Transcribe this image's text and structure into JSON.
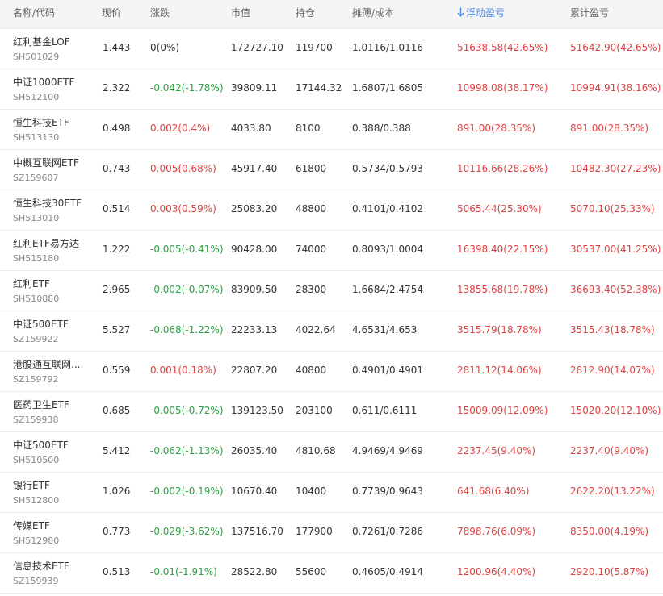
{
  "columns": {
    "name": "名称/代码",
    "price": "现价",
    "change": "涨跌",
    "value": "市值",
    "position": "持仓",
    "cost": "摊薄/成本",
    "float_pl": "浮动盈亏",
    "total_pl": "累计盈亏"
  },
  "sort": {
    "column": "float_pl",
    "direction": "desc",
    "icon": "sort-down-arrow-icon"
  },
  "colors": {
    "up": "#e04040",
    "down": "#2e9f45",
    "accent": "#4a8ae8"
  },
  "rows": [
    {
      "name": "红利基金LOF",
      "code": "SH501029",
      "price": "1.443",
      "change": "0(0%)",
      "change_dir": "flat",
      "value": "172727.10",
      "position": "119700",
      "cost": "1.0116/1.0116",
      "float_pl": "51638.58(42.65%)",
      "total_pl": "51642.90(42.65%)"
    },
    {
      "name": "中证1000ETF",
      "code": "SH512100",
      "price": "2.322",
      "change": "-0.042(-1.78%)",
      "change_dir": "down",
      "value": "39809.11",
      "position": "17144.32",
      "cost": "1.6807/1.6805",
      "float_pl": "10998.08(38.17%)",
      "total_pl": "10994.91(38.16%)"
    },
    {
      "name": "恒生科技ETF",
      "code": "SH513130",
      "price": "0.498",
      "change": "0.002(0.4%)",
      "change_dir": "up",
      "value": "4033.80",
      "position": "8100",
      "cost": "0.388/0.388",
      "float_pl": "891.00(28.35%)",
      "total_pl": "891.00(28.35%)"
    },
    {
      "name": "中概互联网ETF",
      "code": "SZ159607",
      "price": "0.743",
      "change": "0.005(0.68%)",
      "change_dir": "up",
      "value": "45917.40",
      "position": "61800",
      "cost": "0.5734/0.5793",
      "float_pl": "10116.66(28.26%)",
      "total_pl": "10482.30(27.23%)"
    },
    {
      "name": "恒生科技30ETF",
      "code": "SH513010",
      "price": "0.514",
      "change": "0.003(0.59%)",
      "change_dir": "up",
      "value": "25083.20",
      "position": "48800",
      "cost": "0.4101/0.4102",
      "float_pl": "5065.44(25.30%)",
      "total_pl": "5070.10(25.33%)"
    },
    {
      "name": "红利ETF易方达",
      "code": "SH515180",
      "price": "1.222",
      "change": "-0.005(-0.41%)",
      "change_dir": "down",
      "value": "90428.00",
      "position": "74000",
      "cost": "0.8093/1.0004",
      "float_pl": "16398.40(22.15%)",
      "total_pl": "30537.00(41.25%)"
    },
    {
      "name": "红利ETF",
      "code": "SH510880",
      "price": "2.965",
      "change": "-0.002(-0.07%)",
      "change_dir": "down",
      "value": "83909.50",
      "position": "28300",
      "cost": "1.6684/2.4754",
      "float_pl": "13855.68(19.78%)",
      "total_pl": "36693.40(52.38%)"
    },
    {
      "name": "中证500ETF",
      "code": "SZ159922",
      "price": "5.527",
      "change": "-0.068(-1.22%)",
      "change_dir": "down",
      "value": "22233.13",
      "position": "4022.64",
      "cost": "4.6531/4.653",
      "float_pl": "3515.79(18.78%)",
      "total_pl": "3515.43(18.78%)"
    },
    {
      "name": "港股通互联网...",
      "code": "SZ159792",
      "price": "0.559",
      "change": "0.001(0.18%)",
      "change_dir": "up",
      "value": "22807.20",
      "position": "40800",
      "cost": "0.4901/0.4901",
      "float_pl": "2811.12(14.06%)",
      "total_pl": "2812.90(14.07%)"
    },
    {
      "name": "医药卫生ETF",
      "code": "SZ159938",
      "price": "0.685",
      "change": "-0.005(-0.72%)",
      "change_dir": "down",
      "value": "139123.50",
      "position": "203100",
      "cost": "0.611/0.6111",
      "float_pl": "15009.09(12.09%)",
      "total_pl": "15020.20(12.10%)"
    },
    {
      "name": "中证500ETF",
      "code": "SH510500",
      "price": "5.412",
      "change": "-0.062(-1.13%)",
      "change_dir": "down",
      "value": "26035.40",
      "position": "4810.68",
      "cost": "4.9469/4.9469",
      "float_pl": "2237.45(9.40%)",
      "total_pl": "2237.40(9.40%)"
    },
    {
      "name": "银行ETF",
      "code": "SH512800",
      "price": "1.026",
      "change": "-0.002(-0.19%)",
      "change_dir": "down",
      "value": "10670.40",
      "position": "10400",
      "cost": "0.7739/0.9643",
      "float_pl": "641.68(6.40%)",
      "total_pl": "2622.20(13.22%)"
    },
    {
      "name": "传媒ETF",
      "code": "SH512980",
      "price": "0.773",
      "change": "-0.029(-3.62%)",
      "change_dir": "down",
      "value": "137516.70",
      "position": "177900",
      "cost": "0.7261/0.7286",
      "float_pl": "7898.76(6.09%)",
      "total_pl": "8350.00(4.19%)"
    },
    {
      "name": "信息技术ETF",
      "code": "SZ159939",
      "price": "0.513",
      "change": "-0.01(-1.91%)",
      "change_dir": "down",
      "value": "28522.80",
      "position": "55600",
      "cost": "0.4605/0.4914",
      "float_pl": "1200.96(4.40%)",
      "total_pl": "2920.10(5.87%)"
    }
  ]
}
